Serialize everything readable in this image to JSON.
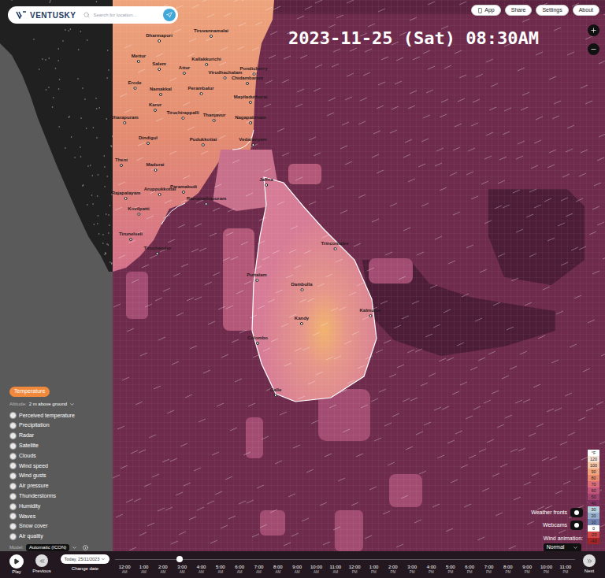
{
  "logo": "VENTUSKY",
  "search": {
    "placeholder": "Search for location..."
  },
  "top_buttons": [
    "App",
    "Share",
    "Settings",
    "About"
  ],
  "timestamp": "2023-11-25 (Sat) 08:30AM",
  "cities": [
    {
      "name": "Dharmapuri"
    },
    {
      "name": "Tiruvannamalai"
    },
    {
      "name": "Mettur"
    },
    {
      "name": "Salem"
    },
    {
      "name": "Kallakkurichi"
    },
    {
      "name": "Pondicherry"
    },
    {
      "name": "Attur"
    },
    {
      "name": "Erode"
    },
    {
      "name": "Namakkal"
    },
    {
      "name": "Perambalur"
    },
    {
      "name": "Virudhachalam"
    },
    {
      "name": "Chidambaram"
    },
    {
      "name": "Karur"
    },
    {
      "name": "Tiruchirappalli"
    },
    {
      "name": "Thanjavur"
    },
    {
      "name": "Mayiladuthurai"
    },
    {
      "name": "Dharapuram"
    },
    {
      "name": "Nagapattinam"
    },
    {
      "name": "Dindigul"
    },
    {
      "name": "Pudukkottai"
    },
    {
      "name": "Vedaranyam"
    },
    {
      "name": "Theni"
    },
    {
      "name": "Madurai"
    },
    {
      "name": "Aruppukkottai"
    },
    {
      "name": "Paramakudi"
    },
    {
      "name": "Rajapalayam"
    },
    {
      "name": "Ramanathapuram"
    },
    {
      "name": "Jaffna"
    },
    {
      "name": "Kovilpatti"
    },
    {
      "name": "Tirunelveli"
    },
    {
      "name": "Tiruchendur"
    },
    {
      "name": "Trincomalee"
    },
    {
      "name": "Puttalam"
    },
    {
      "name": "Dambulla"
    },
    {
      "name": "Kandy"
    },
    {
      "name": "Kalmunai"
    },
    {
      "name": "Colombo"
    },
    {
      "name": "Galle"
    }
  ],
  "layers": {
    "items": [
      {
        "label": "Temperature",
        "selected": true
      },
      {
        "label": "Perceived temperature",
        "selected": false
      },
      {
        "label": "Precipitation",
        "selected": false
      },
      {
        "label": "Radar",
        "selected": false
      },
      {
        "label": "Satellite",
        "selected": false
      },
      {
        "label": "Clouds",
        "selected": false
      },
      {
        "label": "Wind speed",
        "selected": false
      },
      {
        "label": "Wind gusts",
        "selected": false
      },
      {
        "label": "Air pressure",
        "selected": false
      },
      {
        "label": "Thunderstorms",
        "selected": false
      },
      {
        "label": "Humidity",
        "selected": false
      },
      {
        "label": "Waves",
        "selected": false
      },
      {
        "label": "Snow cover",
        "selected": false
      },
      {
        "label": "Air quality",
        "selected": false
      }
    ],
    "altitude": {
      "label": "Altitude:",
      "value": "2 m above ground"
    }
  },
  "model": {
    "label": "Model:",
    "value": "Automatic (ICON)"
  },
  "legend": {
    "unit": "°F",
    "stops": [
      {
        "label": "120",
        "color": "#f6e4d6"
      },
      {
        "label": "100",
        "color": "#f4c6a6"
      },
      {
        "label": "90",
        "color": "#f1a57e"
      },
      {
        "label": "80",
        "color": "#e98a6e"
      },
      {
        "label": "70",
        "color": "#dc6e7c"
      },
      {
        "label": "60",
        "color": "#c2567a"
      },
      {
        "label": "50",
        "color": "#a24470"
      },
      {
        "label": "40",
        "color": "#823262"
      },
      {
        "label": "30",
        "color": "#b8cfdc"
      },
      {
        "label": "20",
        "color": "#94aecb"
      },
      {
        "label": "10",
        "color": "#7384b4"
      },
      {
        "label": "0",
        "color": "#ffffff"
      },
      {
        "label": "-20",
        "color": "#d24646"
      },
      {
        "label": "-40",
        "color": "#a22424"
      }
    ]
  },
  "toggles": [
    {
      "label": "Weather fronts",
      "on": false
    },
    {
      "label": "Webcams",
      "on": false
    }
  ],
  "wind_animation": {
    "label": "Wind animation:",
    "value": "Normal"
  },
  "timeline": {
    "play": "Play",
    "previous": "Previous",
    "date": "Today, 25/11/2023",
    "change_date": "Change date",
    "next": "Next",
    "level": 0.14,
    "hours": [
      {
        "time": "12:00",
        "period": "AM"
      },
      {
        "time": "1:00",
        "period": "AM"
      },
      {
        "time": "2:00",
        "period": "AM"
      },
      {
        "time": "3:00",
        "period": "AM"
      },
      {
        "time": "4:00",
        "period": "AM"
      },
      {
        "time": "5:00",
        "period": "AM"
      },
      {
        "time": "6:00",
        "period": "AM"
      },
      {
        "time": "7:00",
        "period": "AM"
      },
      {
        "time": "8:00",
        "period": "AM"
      },
      {
        "time": "9:00",
        "period": "AM"
      },
      {
        "time": "10:00",
        "period": "AM"
      },
      {
        "time": "11:00",
        "period": "AM"
      },
      {
        "time": "12:00",
        "period": "PM"
      },
      {
        "time": "1:00",
        "period": "PM"
      },
      {
        "time": "2:00",
        "period": "PM"
      },
      {
        "time": "3:00",
        "period": "PM"
      },
      {
        "time": "4:00",
        "period": "PM"
      },
      {
        "time": "5:00",
        "period": "PM"
      },
      {
        "time": "6:00",
        "period": "PM"
      },
      {
        "time": "7:00",
        "period": "PM"
      },
      {
        "time": "8:00",
        "period": "PM"
      },
      {
        "time": "9:00",
        "period": "PM"
      },
      {
        "time": "10:00",
        "period": "PM"
      },
      {
        "time": "11:00",
        "period": "PM"
      }
    ]
  }
}
